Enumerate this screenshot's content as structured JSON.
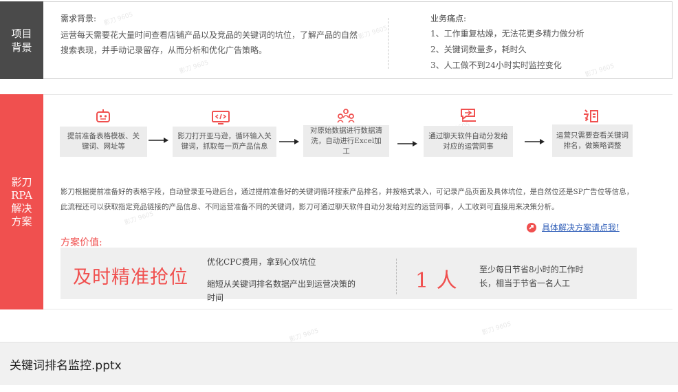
{
  "top": {
    "side_label": "项目背景",
    "need_title": "需求背景:",
    "need_body": "运营每天需要花大量时间查看店铺产品以及竞品的关键词的坑位，了解产品的自然搜索表现，并手动记录留存，从而分析和优化广告策略。",
    "pain_title": "业务痛点:",
    "pain_points": [
      "1、工作重复枯燥，无法花更多精力做分析",
      "2、关键词数量多，耗时久",
      "3、人工做不到24小时实时监控变化"
    ]
  },
  "rpa": {
    "side_label": "影刀RPA解决方案",
    "steps": [
      {
        "icon": "robot-icon",
        "text": "提前准备表格模板、关键词、网址等"
      },
      {
        "icon": "code-monitor-icon",
        "text": "影刀打开亚马逊，循环输入关键词，抓取每一页产品信息"
      },
      {
        "icon": "people-group-icon",
        "text": "对原始数据进行数据清洗，自动进行Excel加工"
      },
      {
        "icon": "chat-send-icon",
        "text": "通过聊天软件自动分发给对应的运营同事"
      },
      {
        "icon": "record-icon",
        "text": "运营只需要查看关键词排名，做策略调整"
      }
    ],
    "description": "影刀根据提前准备好的表格字段，自动登录亚马逊后台，通过提前准备好的关键词循环搜索产品排名，并按格式录入，可记录产品页面及具体坑位，是自然位还是SP广告位等信息，此流程还可以获取指定竞品链接的产品信息、不同运营准备不同的关键词，影刀可通过聊天软件自动分发给对应的运营同事，人工收到可直接用来决策分析。",
    "link_text": "具体解决方案请点我!",
    "value_title": "方案价值:",
    "value_big": "及时精准抢位",
    "value_point_1": "优化CPC费用，拿到心仪坑位",
    "value_point_2": "缩短从关键词排名数据产出到运营决策的时间",
    "saving_big": "1 人",
    "saving_text": "至少每日节省8小时的工作时长，相当于节省一名人工"
  },
  "file": {
    "name": "关键词排名监控.pptx"
  },
  "watermark": "影刀 9605",
  "colors": {
    "accent_red": "#f0504f",
    "side_dark": "#4a4a4a",
    "link_blue": "#2f5eb8"
  }
}
